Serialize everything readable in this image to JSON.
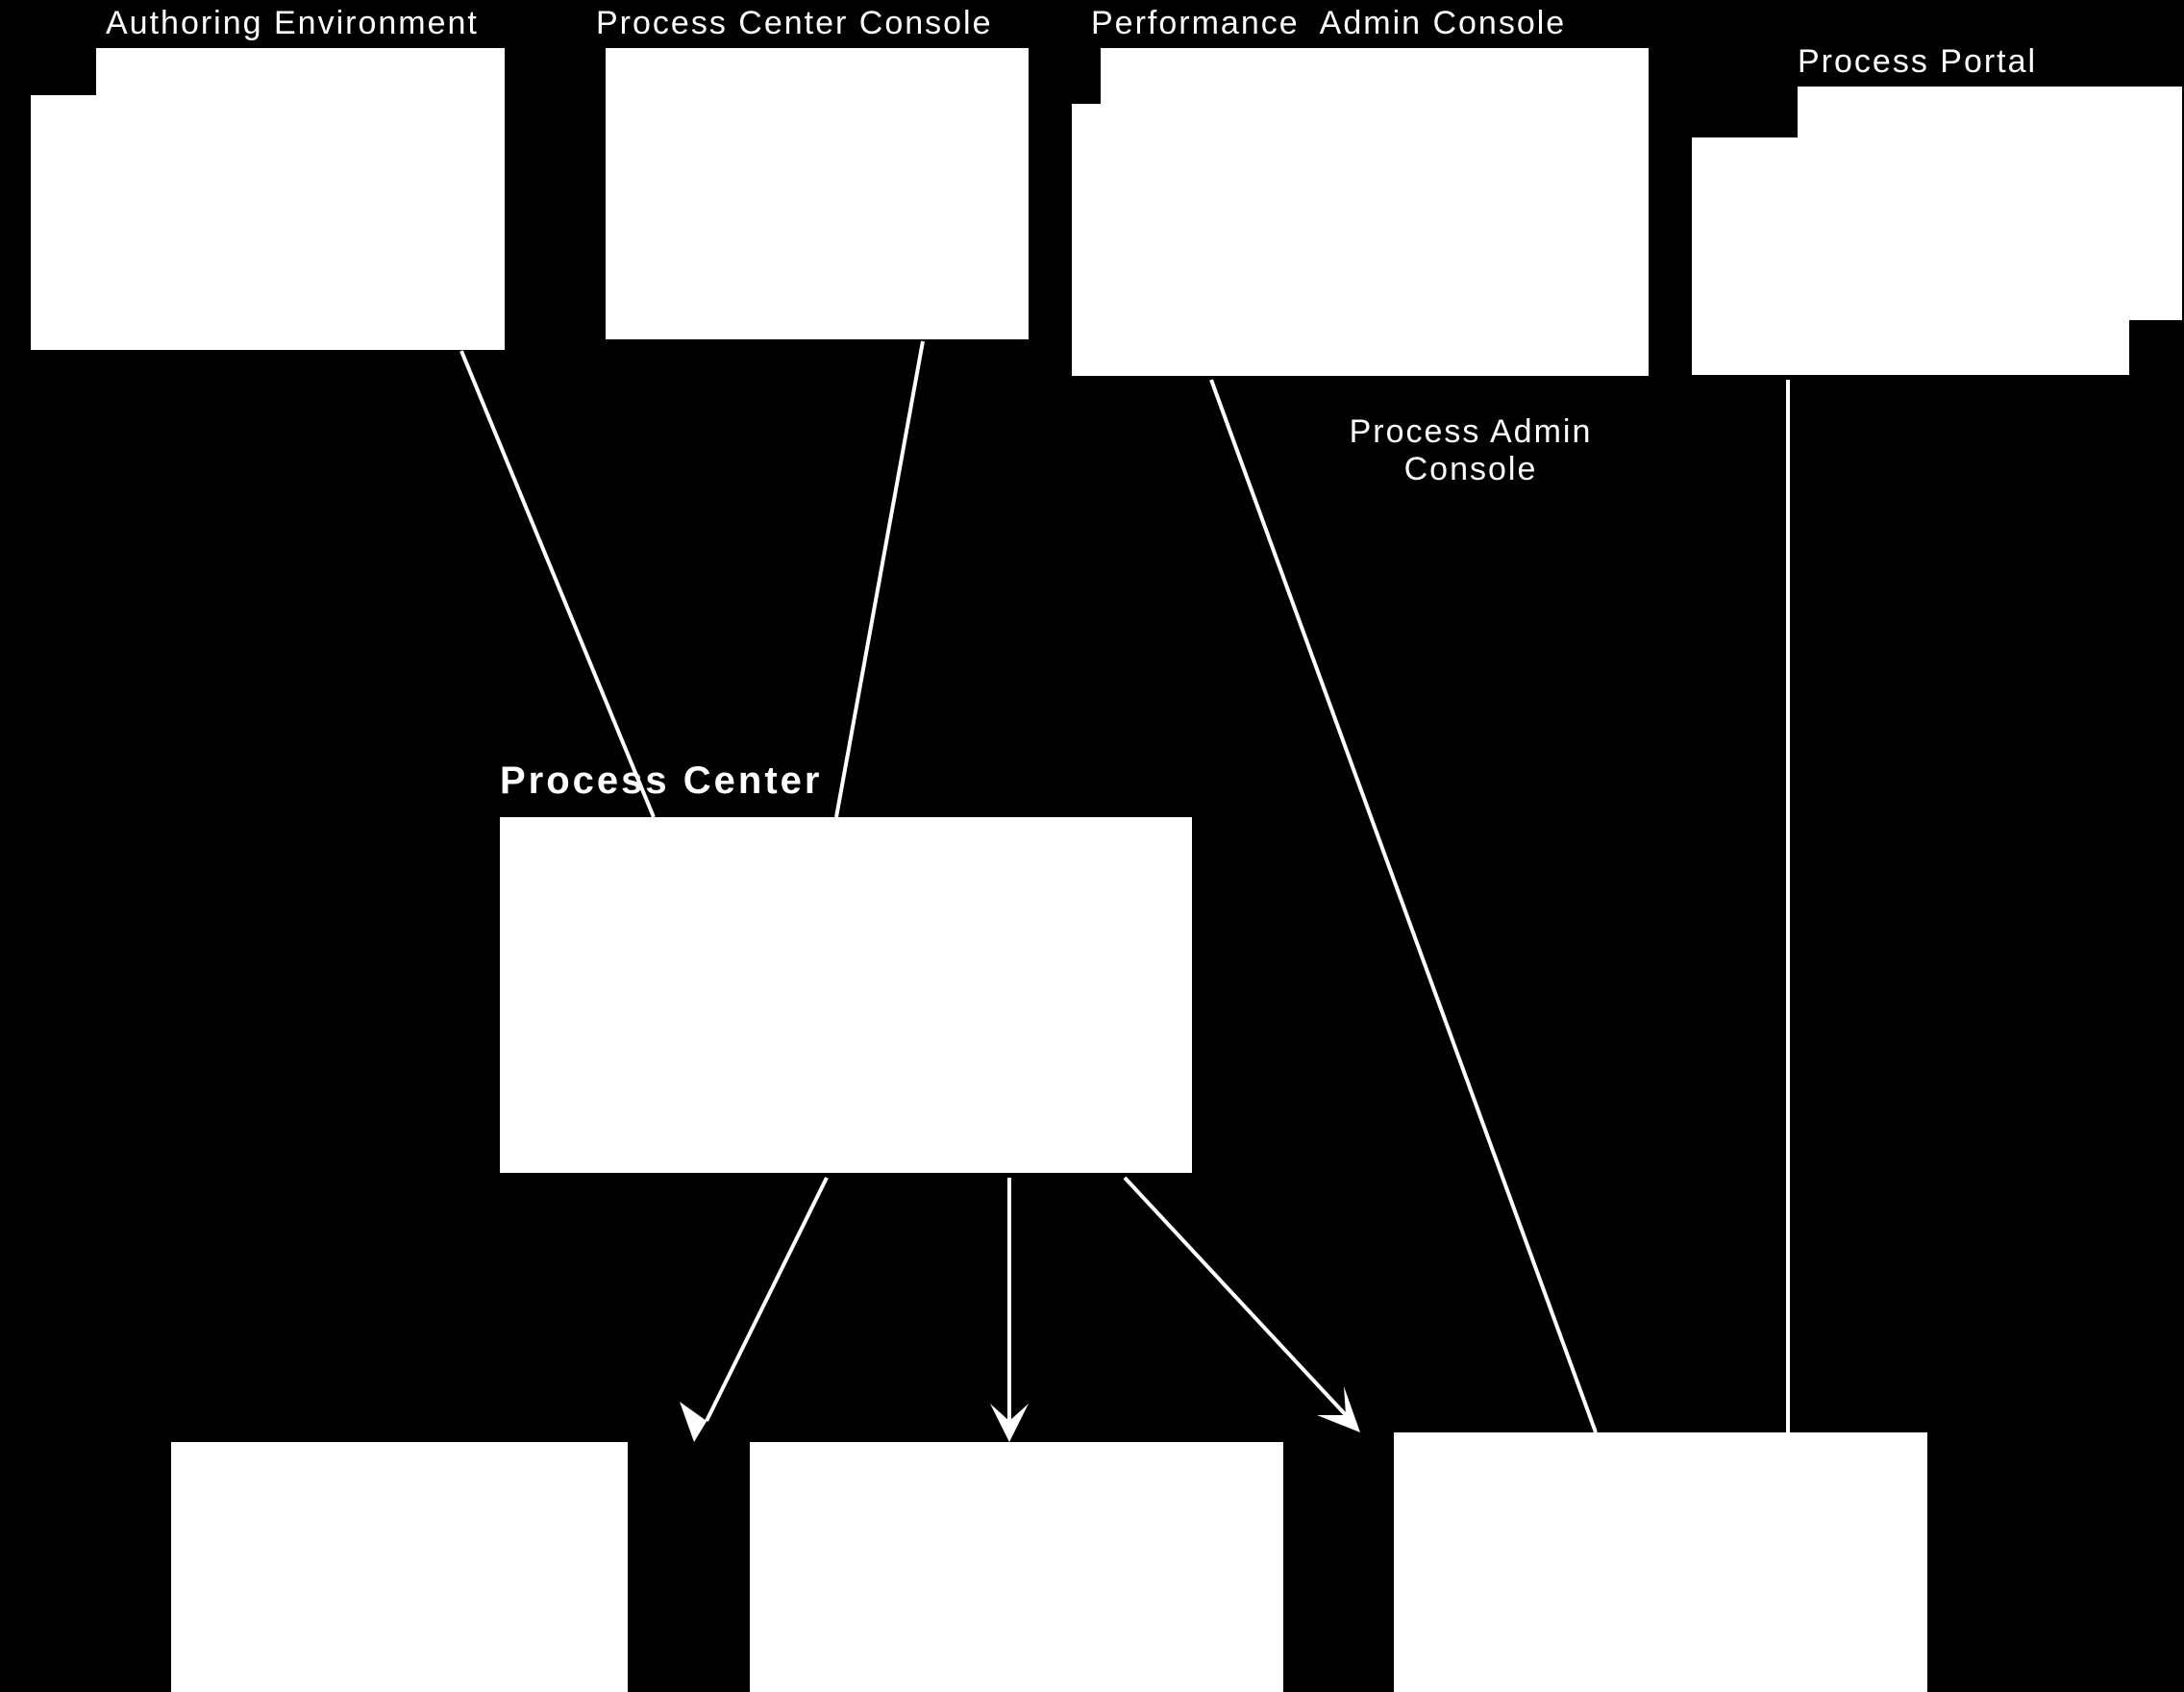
{
  "labels": {
    "authoring_env": "Authoring Environment",
    "pc_console": "Process Center Console",
    "perf_admin": "Performance  Admin Console",
    "process_portal": "Process Portal",
    "process_admin": "Process Admin\nConsole",
    "process_center": "Process Center"
  }
}
